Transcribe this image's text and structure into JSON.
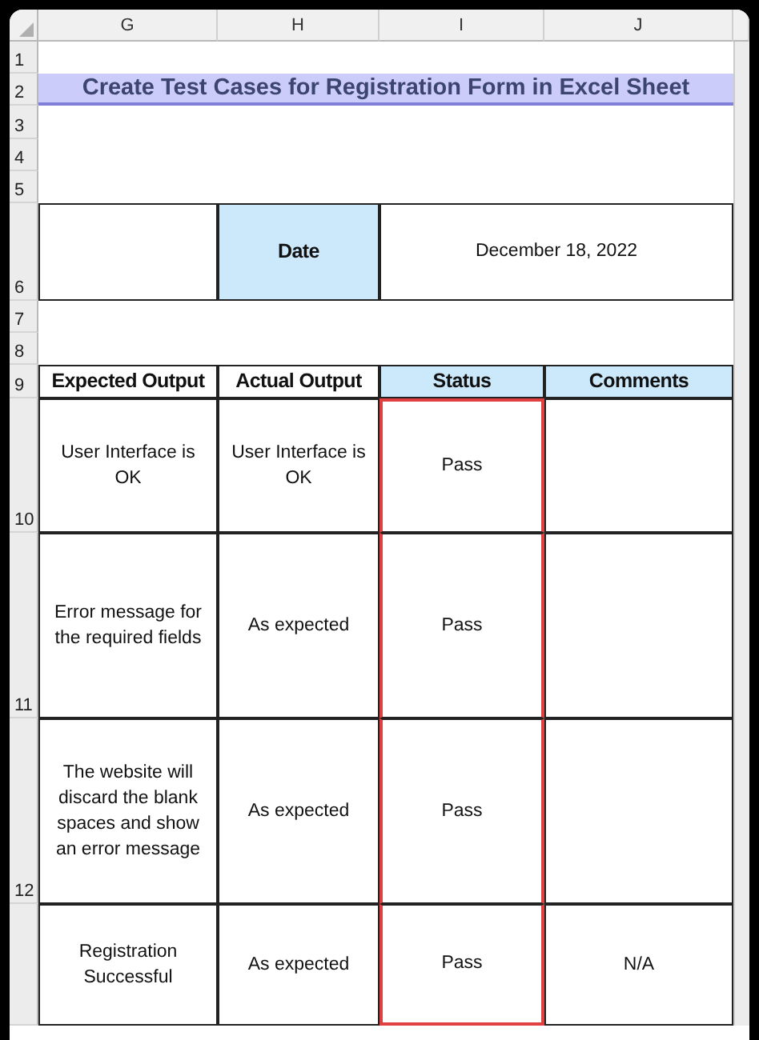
{
  "column_headers": [
    {
      "label": "G"
    },
    {
      "label": "H"
    },
    {
      "label": "I"
    },
    {
      "label": "J"
    }
  ],
  "row_numbers": [
    "1",
    "2",
    "3",
    "4",
    "5",
    "6",
    "7",
    "8",
    "9"
  ],
  "title": "Create Test Cases for Registration Form in Excel Sheet",
  "date": {
    "label": "Date",
    "value": "December 18, 2022"
  },
  "table": {
    "columns": [
      {
        "label": "Expected Output",
        "shaded": false,
        "selected": false
      },
      {
        "label": "Actual Output",
        "shaded": false,
        "selected": false
      },
      {
        "label": "Status",
        "shaded": true,
        "selected": true
      },
      {
        "label": "Comments",
        "shaded": true,
        "selected": false
      }
    ],
    "rows": [
      {
        "number": "10",
        "cells": [
          "User Interface is OK",
          "User Interface is OK",
          "Pass",
          ""
        ]
      },
      {
        "number": "11",
        "cells": [
          "Error message for the required fields",
          "As expected",
          "Pass",
          ""
        ]
      },
      {
        "number": "12",
        "cells": [
          "The website will discard the blank spaces and show an error message",
          "As expected",
          "Pass",
          ""
        ]
      },
      {
        "number": "",
        "cells": [
          "Registration Successful",
          "As expected",
          "Pass",
          "N/A"
        ]
      }
    ]
  }
}
